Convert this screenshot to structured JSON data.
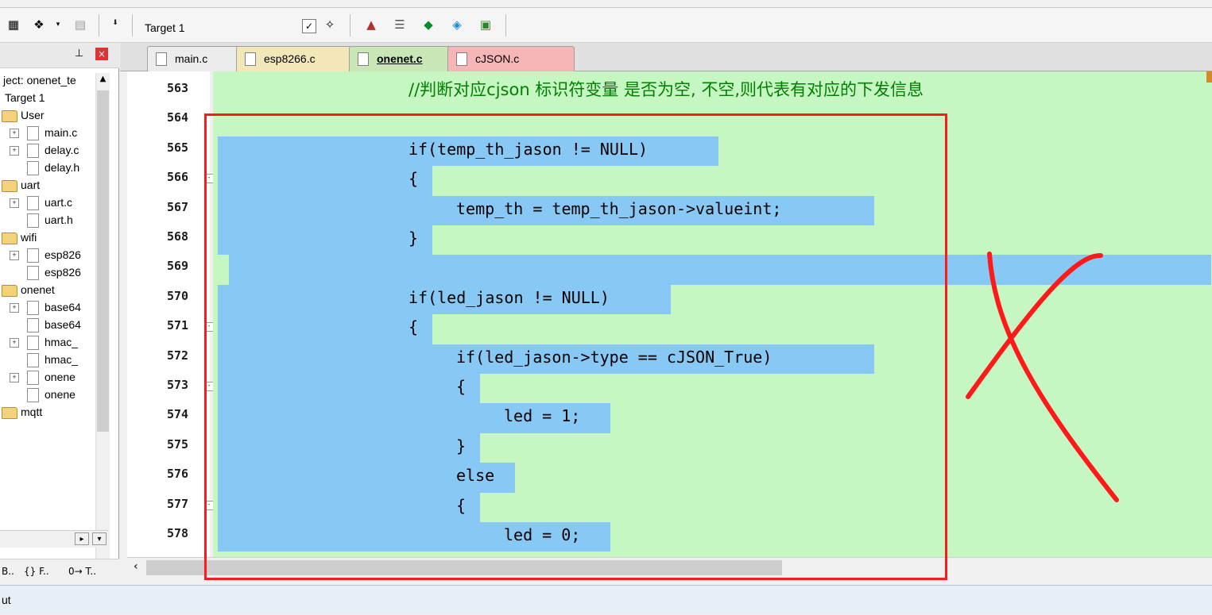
{
  "toolbar": {
    "target_value": "Target 1",
    "icons": [
      "build-icon",
      "translate-icon",
      "rebuild-icon",
      "load-icon",
      "manage-icon",
      "magic-wand-icon",
      "components-icon",
      "copy-icon",
      "diamond-icon",
      "pack-icon",
      "books-icon"
    ]
  },
  "project_panel": {
    "pin": "ᵖ",
    "close": "×",
    "tree": [
      {
        "label": "ject: onenet_te",
        "kind": "project"
      },
      {
        "label": "Target 1",
        "kind": "target"
      },
      {
        "label": "User",
        "kind": "folder"
      },
      {
        "label": "main.c",
        "kind": "file",
        "expand": true
      },
      {
        "label": "delay.c",
        "kind": "file",
        "expand": true
      },
      {
        "label": "delay.h",
        "kind": "file",
        "expand": false
      },
      {
        "label": "uart",
        "kind": "folder"
      },
      {
        "label": "uart.c",
        "kind": "file",
        "expand": true
      },
      {
        "label": "uart.h",
        "kind": "file",
        "expand": false
      },
      {
        "label": "wifi",
        "kind": "folder"
      },
      {
        "label": "esp826",
        "kind": "file",
        "expand": true
      },
      {
        "label": "esp826",
        "kind": "file",
        "expand": false
      },
      {
        "label": "onenet",
        "kind": "folder"
      },
      {
        "label": "base64",
        "kind": "file",
        "expand": true
      },
      {
        "label": "base64",
        "kind": "file",
        "expand": false
      },
      {
        "label": "hmac_",
        "kind": "file",
        "expand": true
      },
      {
        "label": "hmac_",
        "kind": "file",
        "expand": false
      },
      {
        "label": "onene",
        "kind": "file",
        "expand": true
      },
      {
        "label": "onene",
        "kind": "file",
        "expand": false
      },
      {
        "label": "mqtt",
        "kind": "folder"
      }
    ],
    "bottom_tabs": [
      "B..",
      "{} F..",
      "0→ T.."
    ]
  },
  "editor": {
    "tabs": [
      {
        "label": "main.c",
        "color": "#ececec",
        "active": false
      },
      {
        "label": "esp8266.c",
        "color": "#f2e7b8",
        "active": false
      },
      {
        "label": "onenet.c",
        "color": "#c9e7b6",
        "active": true
      },
      {
        "label": "cJSON.c",
        "color": "#f4b6b6",
        "active": false
      }
    ],
    "lines": [
      {
        "num": "563",
        "text": "//判断对应cjson 标识符变量 是否为空, 不空,则代表有对应的下发信息",
        "indent": 0,
        "comment": true
      },
      {
        "num": "564",
        "text": "",
        "indent": 0
      },
      {
        "num": "565",
        "text": "if(temp_th_jason != NULL)",
        "indent": 0
      },
      {
        "num": "566",
        "text": "{",
        "indent": 0
      },
      {
        "num": "567",
        "text": "temp_th = temp_th_jason->valueint;",
        "indent": 1
      },
      {
        "num": "568",
        "text": "}",
        "indent": 0
      },
      {
        "num": "569",
        "text": "",
        "indent": 0
      },
      {
        "num": "570",
        "text": "if(led_jason != NULL)",
        "indent": 0
      },
      {
        "num": "571",
        "text": "{",
        "indent": 0
      },
      {
        "num": "572",
        "text": "if(led_jason->type == cJSON_True)",
        "indent": 1
      },
      {
        "num": "573",
        "text": "{",
        "indent": 1
      },
      {
        "num": "574",
        "text": "led = 1;",
        "indent": 2
      },
      {
        "num": "575",
        "text": "}",
        "indent": 1
      },
      {
        "num": "576",
        "text": "else",
        "indent": 1
      },
      {
        "num": "577",
        "text": "{",
        "indent": 1
      },
      {
        "num": "578",
        "text": "led = 0;",
        "indent": 2
      }
    ]
  },
  "statusbar": {
    "text": "ut"
  },
  "colors": {
    "code_bg": "#c6f7c3",
    "selection": "#88c8f4",
    "annotation": "#ff1a1a",
    "comment": "#008000"
  }
}
